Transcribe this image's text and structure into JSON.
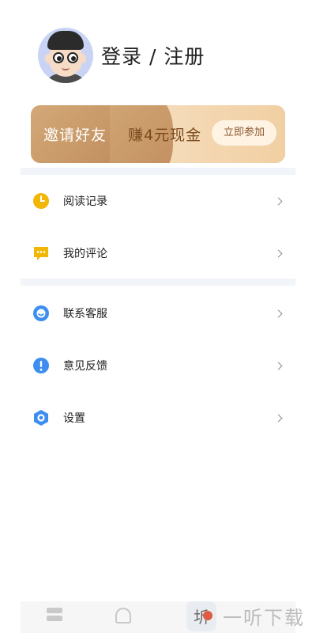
{
  "header": {
    "login_label": "登录 / 注册"
  },
  "banner": {
    "invite_label": "邀请好友",
    "earn_label": "赚4元现金",
    "join_label": "立即参加"
  },
  "menu": {
    "group1": [
      {
        "label": "阅读记录",
        "icon": "clock-icon",
        "color": "#f2b705"
      },
      {
        "label": "我的评论",
        "icon": "comment-icon",
        "color": "#f2b705"
      }
    ],
    "group2": [
      {
        "label": "联系客服",
        "icon": "service-icon",
        "color": "#3d8ef0"
      },
      {
        "label": "意见反馈",
        "icon": "feedback-icon",
        "color": "#3d8ef0"
      },
      {
        "label": "设置",
        "icon": "settings-icon",
        "color": "#3d8ef0"
      }
    ]
  },
  "watermark": {
    "logo_glyph": "圻",
    "text": "一听下载"
  },
  "colors": {
    "accent_yellow": "#f2b705",
    "accent_blue": "#3d8ef0",
    "banner_gold": "#c08d5d"
  }
}
